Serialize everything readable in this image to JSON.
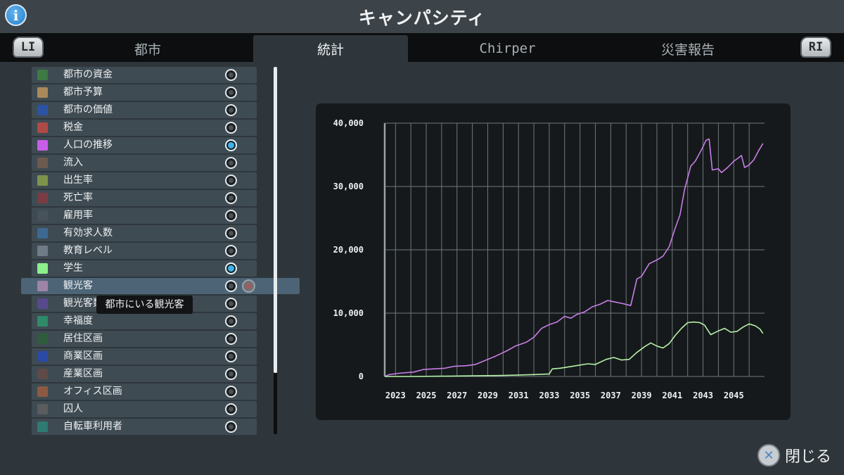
{
  "header": {
    "title": "キャンパシティ",
    "info_icon": "info-icon"
  },
  "tabs": [
    {
      "label": "都市",
      "active": false
    },
    {
      "label": "統計",
      "active": true
    },
    {
      "label": "Chirper",
      "active": false
    },
    {
      "label": "災害報告",
      "active": false
    }
  ],
  "bumpers": {
    "left": "LI",
    "right": "RI"
  },
  "stats": [
    {
      "label": "都市の資金",
      "color": "#3d7a44",
      "selected": false
    },
    {
      "label": "都市予算",
      "color": "#a9895a",
      "selected": false
    },
    {
      "label": "都市の価値",
      "color": "#2c52a3",
      "selected": false
    },
    {
      "label": "税金",
      "color": "#b04a47",
      "selected": false
    },
    {
      "label": "人口の推移",
      "color": "#c85ee8",
      "selected": true
    },
    {
      "label": "流入",
      "color": "#6d5a4e",
      "selected": false
    },
    {
      "label": "出生率",
      "color": "#7c934a",
      "selected": false
    },
    {
      "label": "死亡率",
      "color": "#7a3c44",
      "selected": false
    },
    {
      "label": "雇用率",
      "color": "#48525a",
      "selected": false
    },
    {
      "label": "有効求人数",
      "color": "#3d6890",
      "selected": false
    },
    {
      "label": "教育レベル",
      "color": "#6f7c87",
      "selected": false
    },
    {
      "label": "学生",
      "color": "#8cf08c",
      "selected": true
    },
    {
      "label": "観光客",
      "color": "#9d84a7",
      "selected": false
    },
    {
      "label": "観光客数",
      "color": "#574a8c",
      "selected": false
    },
    {
      "label": "幸福度",
      "color": "#2f8a69",
      "selected": false
    },
    {
      "label": "居住区画",
      "color": "#2f5c3c",
      "selected": false
    },
    {
      "label": "商業区画",
      "color": "#2a4aa3",
      "selected": false
    },
    {
      "label": "産業区画",
      "color": "#5e4a48",
      "selected": false
    },
    {
      "label": "オフィス区画",
      "color": "#8c5a42",
      "selected": false
    },
    {
      "label": "囚人",
      "color": "#5a5c5e",
      "selected": false
    },
    {
      "label": "自転車利用者",
      "color": "#2f7a72",
      "selected": false
    }
  ],
  "highlighted_index": 12,
  "tooltip": {
    "text": "都市にいる観光客"
  },
  "chart_data": {
    "type": "line",
    "title": "",
    "xlabel": "",
    "ylabel": "",
    "xlim": [
      2022.3,
      2047.0
    ],
    "ylim": [
      0,
      40000
    ],
    "x_ticks": [
      2023,
      2025,
      2027,
      2029,
      2031,
      2033,
      2035,
      2037,
      2039,
      2041,
      2043,
      2045
    ],
    "y_ticks": [
      0,
      10000,
      20000,
      30000,
      40000
    ],
    "y_tick_labels": [
      "0",
      "10,000",
      "20,000",
      "30,000",
      "40,000"
    ],
    "grid": true,
    "series": [
      {
        "color": "#c87ee8",
        "points": [
          [
            2022.3,
            0
          ],
          [
            2022.6,
            300
          ],
          [
            2023.2,
            500
          ],
          [
            2024.2,
            700
          ],
          [
            2024.8,
            1100
          ],
          [
            2025.5,
            1200
          ],
          [
            2026.2,
            1300
          ],
          [
            2026.8,
            1600
          ],
          [
            2027.6,
            1700
          ],
          [
            2028.2,
            1900
          ],
          [
            2028.8,
            2500
          ],
          [
            2029.5,
            3200
          ],
          [
            2030.2,
            4000
          ],
          [
            2030.8,
            4800
          ],
          [
            2031.5,
            5400
          ],
          [
            2032.0,
            6200
          ],
          [
            2032.5,
            7600
          ],
          [
            2033.0,
            8200
          ],
          [
            2033.5,
            8600
          ],
          [
            2034.0,
            9500
          ],
          [
            2034.4,
            9200
          ],
          [
            2034.8,
            9800
          ],
          [
            2035.3,
            10200
          ],
          [
            2035.8,
            11000
          ],
          [
            2036.3,
            11400
          ],
          [
            2036.8,
            12000
          ],
          [
            2037.2,
            11800
          ],
          [
            2037.8,
            11500
          ],
          [
            2038.3,
            11200
          ],
          [
            2038.7,
            15400
          ],
          [
            2039.0,
            15800
          ],
          [
            2039.5,
            17800
          ],
          [
            2040.0,
            18400
          ],
          [
            2040.4,
            19000
          ],
          [
            2040.8,
            20500
          ],
          [
            2041.2,
            23500
          ],
          [
            2041.5,
            25500
          ],
          [
            2041.8,
            29500
          ],
          [
            2042.2,
            33200
          ],
          [
            2042.5,
            34000
          ],
          [
            2042.9,
            35800
          ],
          [
            2043.2,
            37300
          ],
          [
            2043.4,
            37500
          ],
          [
            2043.6,
            32600
          ],
          [
            2044.0,
            32800
          ],
          [
            2044.2,
            32200
          ],
          [
            2044.6,
            33000
          ],
          [
            2045.0,
            34000
          ],
          [
            2045.3,
            34500
          ],
          [
            2045.5,
            34900
          ],
          [
            2045.7,
            33000
          ],
          [
            2046.0,
            33400
          ],
          [
            2046.3,
            34200
          ],
          [
            2046.6,
            35600
          ],
          [
            2046.9,
            36800
          ]
        ]
      },
      {
        "color": "#b6f2a8",
        "points": [
          [
            2022.3,
            0
          ],
          [
            2024.0,
            0
          ],
          [
            2026.0,
            50
          ],
          [
            2028.0,
            100
          ],
          [
            2030.0,
            150
          ],
          [
            2032.0,
            300
          ],
          [
            2033.0,
            400
          ],
          [
            2033.2,
            1200
          ],
          [
            2033.7,
            1300
          ],
          [
            2034.5,
            1600
          ],
          [
            2035.5,
            2000
          ],
          [
            2036.0,
            1900
          ],
          [
            2036.7,
            2700
          ],
          [
            2037.2,
            3000
          ],
          [
            2037.7,
            2600
          ],
          [
            2038.2,
            2700
          ],
          [
            2038.7,
            3800
          ],
          [
            2039.2,
            4700
          ],
          [
            2039.6,
            5300
          ],
          [
            2040.0,
            4800
          ],
          [
            2040.4,
            4500
          ],
          [
            2040.8,
            5200
          ],
          [
            2041.2,
            6500
          ],
          [
            2041.6,
            7600
          ],
          [
            2042.0,
            8500
          ],
          [
            2042.4,
            8600
          ],
          [
            2042.8,
            8500
          ],
          [
            2043.1,
            8100
          ],
          [
            2043.5,
            6600
          ],
          [
            2044.0,
            7200
          ],
          [
            2044.4,
            7600
          ],
          [
            2044.8,
            7000
          ],
          [
            2045.2,
            7100
          ],
          [
            2045.6,
            7800
          ],
          [
            2046.0,
            8300
          ],
          [
            2046.4,
            8000
          ],
          [
            2046.7,
            7500
          ],
          [
            2046.9,
            6800
          ]
        ]
      }
    ]
  },
  "footer": {
    "close_label": "閉じる",
    "close_icon": "cross-button-icon"
  }
}
